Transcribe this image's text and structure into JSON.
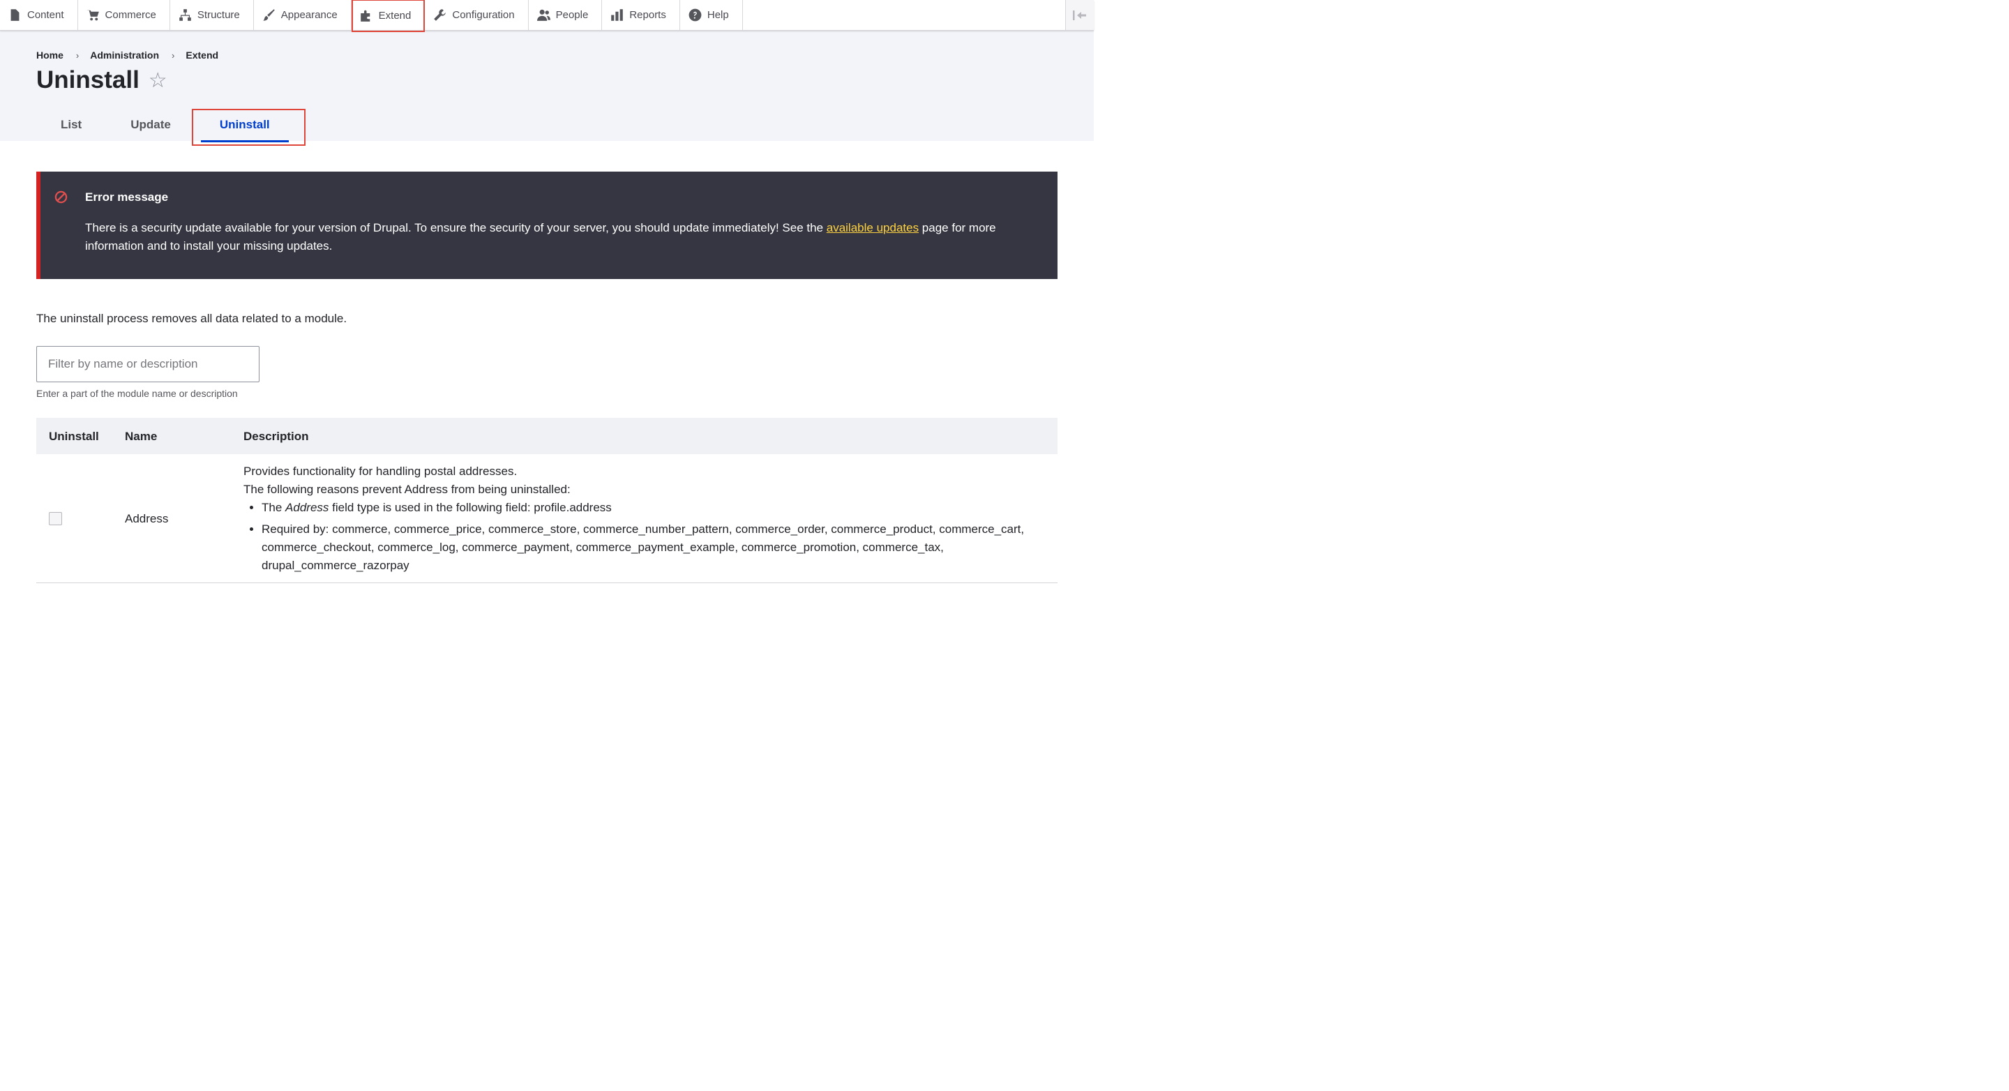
{
  "toolbar": {
    "items": [
      {
        "label": "Content",
        "icon": "file-icon"
      },
      {
        "label": "Commerce",
        "icon": "cart-icon"
      },
      {
        "label": "Structure",
        "icon": "sitemap-icon"
      },
      {
        "label": "Appearance",
        "icon": "paintbrush-icon"
      },
      {
        "label": "Extend",
        "icon": "puzzle-icon"
      },
      {
        "label": "Configuration",
        "icon": "wrench-icon"
      },
      {
        "label": "People",
        "icon": "people-icon"
      },
      {
        "label": "Reports",
        "icon": "bar-chart-icon"
      },
      {
        "label": "Help",
        "icon": "help-icon"
      }
    ],
    "highlight_color": "#e0453a"
  },
  "breadcrumb": [
    "Home",
    "Administration",
    "Extend"
  ],
  "page": {
    "title": "Uninstall"
  },
  "tabs": [
    {
      "label": "List",
      "active": false
    },
    {
      "label": "Update",
      "active": false
    },
    {
      "label": "Uninstall",
      "active": true
    }
  ],
  "message": {
    "title": "Error message",
    "text_before": "There is a security update available for your version of Drupal. To ensure the security of your server, you should update immediately! See the ",
    "link": "available updates",
    "text_after": " page for more information and to install your missing updates."
  },
  "intro": "The uninstall process removes all data related to a module.",
  "filter": {
    "placeholder": "Filter by name or description",
    "help": "Enter a part of the module name or description"
  },
  "table": {
    "headers": [
      "Uninstall",
      "Name",
      "Description"
    ],
    "rows": [
      {
        "name": "Address",
        "description": "Provides functionality for handling postal addresses.",
        "reasons_intro": "The following reasons prevent Address from being uninstalled:",
        "reason_1_a": "The ",
        "reason_1_em": "Address",
        "reason_1_b": " field type is used in the following field: profile.address",
        "reason_2": "Required by: commerce, commerce_price, commerce_store, commerce_number_pattern, commerce_order, commerce_product, commerce_cart, commerce_checkout, commerce_log, commerce_payment, commerce_payment_example, commerce_promotion, commerce_tax, drupal_commerce_razorpay"
      }
    ]
  },
  "colors": {
    "accent": "#003ecc",
    "error_border": "#d72222",
    "message_bg": "#353641",
    "link_yellow": "#ffd23f"
  }
}
